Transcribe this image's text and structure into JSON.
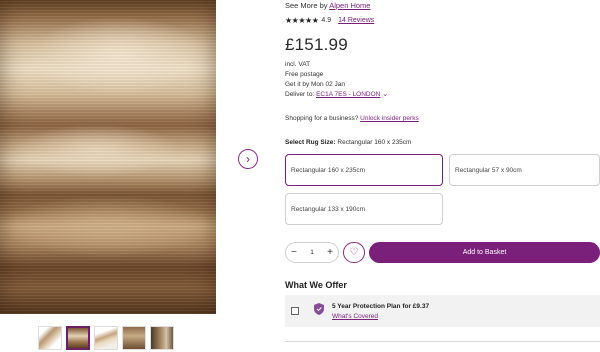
{
  "product": {
    "see_more_prefix": "See More by",
    "brand_link": "Alpen Home",
    "stars": "★★★★★",
    "rating": "4.9",
    "reviews": "14 Reviews",
    "price": "£151.99",
    "vat": "incl. VAT",
    "postage": "Free postage",
    "delivery": "Get it by Mon 02 Jan",
    "deliver_to_label": "Deliver to:",
    "deliver_to_value": "EC1A 7ES - LONDON",
    "business_text": "Shopping for a business?",
    "business_link": "Unlock insider perks",
    "size_label": "Select Rug Size:",
    "size_selected": "Rectangular 160 x 235cm"
  },
  "size_options": [
    "Rectangular 160 x 235cm",
    "Rectangular 57 x 90cm",
    "Rectangular 133 x 190cm"
  ],
  "quantity": {
    "minus": "−",
    "value": "1",
    "plus": "+"
  },
  "actions": {
    "add_to_basket": "Add to Basket"
  },
  "offer": {
    "title": "What We Offer",
    "plan_title": "5 Year Protection Plan for £9.37",
    "plan_link": "What's Covered"
  },
  "icons": {
    "next": "chevron-right-icon",
    "wishlist": "heart-icon",
    "protection": "shield-icon"
  },
  "colors": {
    "accent": "#7a1f7a",
    "offer_bg": "#f2f2f2"
  }
}
